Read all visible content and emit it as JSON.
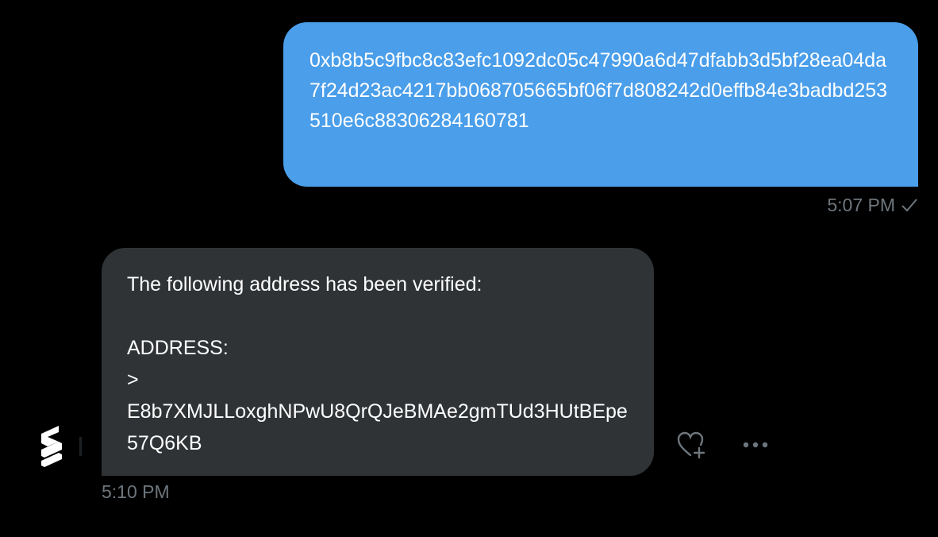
{
  "conversation": {
    "sent_message": {
      "text": "0xb8b5c9fbc8c83efc1092dc05c47990a6d47dfabb3d5bf28ea04da7f24d23ac4217bb068705665bf06f7d808242d0effb84e3badbd253510e6c88306284160781",
      "time": "5:07 PM",
      "status_icon": "check-icon",
      "bubble_color": "#4a9eea"
    },
    "received_message": {
      "text": "The following address has been verified:\n\nADDRESS:\n> \nE8b7XMJLLoxghNPwU8QrQJeBMAe2gmTUd3HUtBEpe57Q6KB",
      "time": "5:10 PM",
      "sender_avatar_icon": "bot-logo-icon",
      "bubble_color": "#2f3336"
    },
    "actions": {
      "react_icon": "heart-plus-icon",
      "more_icon": "more-horizontal-icon"
    }
  },
  "colors": {
    "background": "#000000",
    "muted_text": "#6e767d"
  }
}
